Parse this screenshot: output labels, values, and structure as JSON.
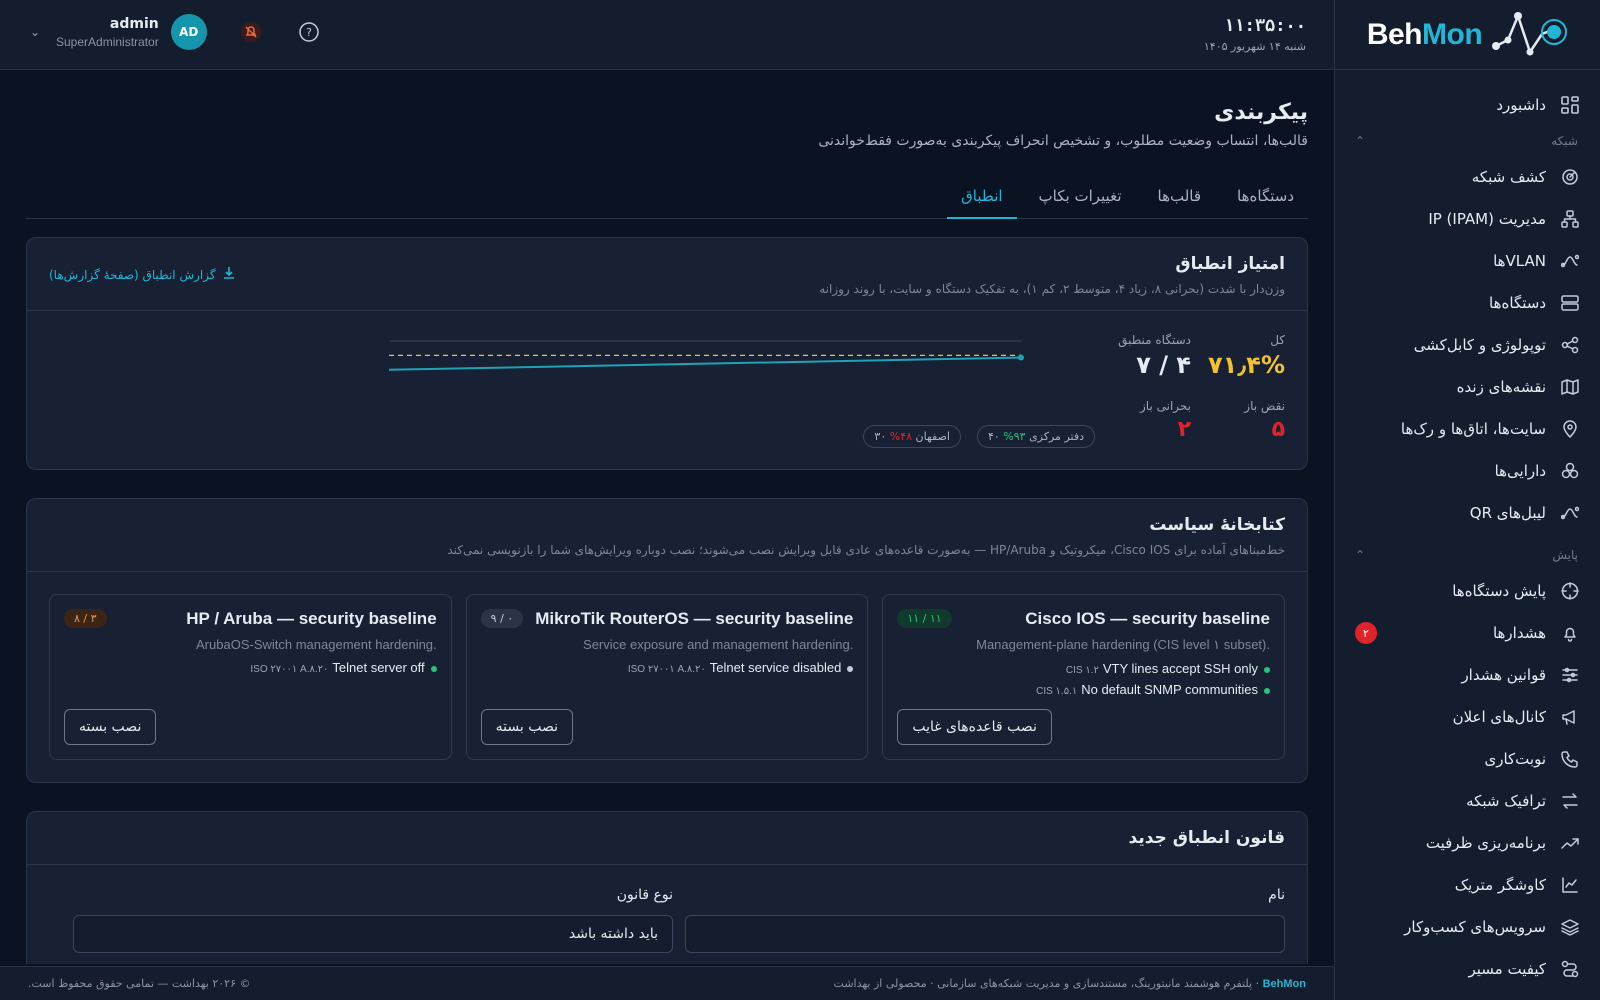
{
  "brand": {
    "part1": "Beh",
    "part2": "Mon"
  },
  "header": {
    "time": "۱۱:۳۵:۰۰",
    "date": "شنبه ۱۴ شهریور ۱۴۰۵",
    "user_name": "admin",
    "user_role": "SuperAdministrator",
    "avatar_initials": "AD"
  },
  "sidebar": {
    "dashboard": "داشبورد",
    "section_network": "شبکه",
    "section_monitoring": "پایش",
    "network_items": [
      {
        "label": "کشف شبکه",
        "icon": "radar-icon"
      },
      {
        "label": "مدیریت IP (IPAM)",
        "icon": "network-tree-icon"
      },
      {
        "label": "VLANها",
        "icon": "vlan-icon"
      },
      {
        "label": "دستگاه‌ها",
        "icon": "server-icon"
      },
      {
        "label": "توپولوژی و کابل‌کشی",
        "icon": "share-icon"
      },
      {
        "label": "نقشه‌های زنده",
        "icon": "map-icon"
      },
      {
        "label": "سایت‌ها، اتاق‌ها و رک‌ها",
        "icon": "location-pin-icon"
      },
      {
        "label": "دارایی‌ها",
        "icon": "boxes-icon"
      },
      {
        "label": "لیبل‌های QR",
        "icon": "qr-label-icon"
      }
    ],
    "monitoring_items": [
      {
        "label": "پایش دستگاه‌ها",
        "icon": "crosshair-icon"
      },
      {
        "label": "هشدارها",
        "icon": "bell-icon",
        "badge": "۲"
      },
      {
        "label": "قوانین هشدار",
        "icon": "sliders-icon"
      },
      {
        "label": "کانال‌های اعلان",
        "icon": "megaphone-icon"
      },
      {
        "label": "نوبت‌کاری",
        "icon": "phone-icon"
      },
      {
        "label": "ترافیک شبکه",
        "icon": "arrows-icon"
      },
      {
        "label": "برنامه‌ریزی ظرفیت",
        "icon": "trend-icon"
      },
      {
        "label": "کاوشگر متریک",
        "icon": "line-chart-icon"
      },
      {
        "label": "سرویس‌های کسب‌وکار",
        "icon": "layers-icon"
      },
      {
        "label": "کیفیت مسیر",
        "icon": "route-icon"
      }
    ]
  },
  "page": {
    "title": "پیکربندی",
    "subtitle": "قالب‌ها، انتساب وضعیت مطلوب، و تشخیص انحراف پیکربندی به‌صورت فقط‌خواندنی",
    "tabs": [
      "دستگاه‌ها",
      "قالب‌ها",
      "تغییرات بکاپ",
      "انطباق"
    ],
    "active_tab": "انطباق"
  },
  "score_card": {
    "title": "امتیاز انطباق",
    "subtitle": "وزن‌دار با شدت (بحرانی ۸، زیاد ۴، متوسط ۲، کم ۱)، به تفکیک دستگاه و سایت، با روند روزانه",
    "report_link": "گزارش انطباق (صفحهٔ گزارش‌ها)",
    "total_label": "کل",
    "total_value": "۷۱٫۴%",
    "total_pct": 71.4,
    "compliant_label": "دستگاه منطبق",
    "compliant_value": "۴ / ۷",
    "open_violations_label": "نقض باز",
    "open_violations_value": "۵",
    "open_critical_label": "بحرانی باز",
    "open_critical_value": "۲",
    "sites": [
      {
        "name": "دفتر مرکزی",
        "pct": "۹۳%",
        "count": "۴۰",
        "color": "#27c47a"
      },
      {
        "name": "اصفهان",
        "pct": "۴۸%",
        "count": "۳۰",
        "color": "#e0222b"
      }
    ],
    "trend": {
      "start": 68,
      "end": 71.4,
      "target": 72
    }
  },
  "policy_library": {
    "title": "کتابخانهٔ سیاست",
    "subtitle": "خط‌مبناهای آماده برای Cisco IOS، میکروتیک و HP/Aruba — به‌صورت قاعده‌های عادی قابل ویرایش نصب می‌شوند؛ نصب دوباره ویرایش‌های شما را بازنویسی نمی‌کند",
    "cards": [
      {
        "title": "Cisco IOS — security baseline",
        "desc": "Management-plane hardening (CIS level ۱ subset).",
        "badge": "۱۱ / ۱۱",
        "badge_bg": "#0f3a2c",
        "badge_fg": "#27c47a",
        "controls": [
          {
            "text": "VTY lines accept SSH only",
            "ref": "CIS ۱.۲",
            "dot": "#27c47a"
          },
          {
            "text": "No default SNMP communities",
            "ref": "CIS ۱.۵.۱",
            "dot": "#27c47a"
          }
        ],
        "button": "نصب قاعده‌های غایب"
      },
      {
        "title": "MikroTik RouterOS — security baseline",
        "desc": "Service exposure and management hardening.",
        "badge": "۰ / ۹",
        "badge_bg": "#2a3446",
        "badge_fg": "#c3ccd9",
        "controls": [
          {
            "text": "Telnet service disabled",
            "ref": "ISO ۲۷۰۰۱ A.۸.۲۰",
            "dot": "#c3ccd9"
          }
        ],
        "button": "نصب بسته"
      },
      {
        "title": "HP / Aruba — security baseline",
        "desc": "ArubaOS-Switch management hardening.",
        "badge": "۳ / ۸",
        "badge_bg": "#3d2516",
        "badge_fg": "#e59a54",
        "controls": [
          {
            "text": "Telnet server off",
            "ref": "ISO ۲۷۰۰۱ A.۸.۲۰",
            "dot": "#27c47a"
          }
        ],
        "button": "نصب بسته"
      }
    ]
  },
  "new_rule": {
    "title": "قانون انطباق جدید",
    "name_label": "نام",
    "type_label": "نوع قانون",
    "type_value": "باید داشته باشد"
  },
  "footer": {
    "brand": "BehMon",
    "tagline": "پلتفرم هوشمند مانیتورینگ، مستندسازی و مدیریت شبکه‌های سازمانی",
    "product": "محصولی از بهداشت",
    "copyright": "© ۲۰۲۶ بهداشت — تمامی حقوق محفوظ است."
  },
  "colors": {
    "accent": "#21b6d6",
    "score": "#f2c12e",
    "danger": "#e0222b",
    "success": "#27c47a"
  }
}
